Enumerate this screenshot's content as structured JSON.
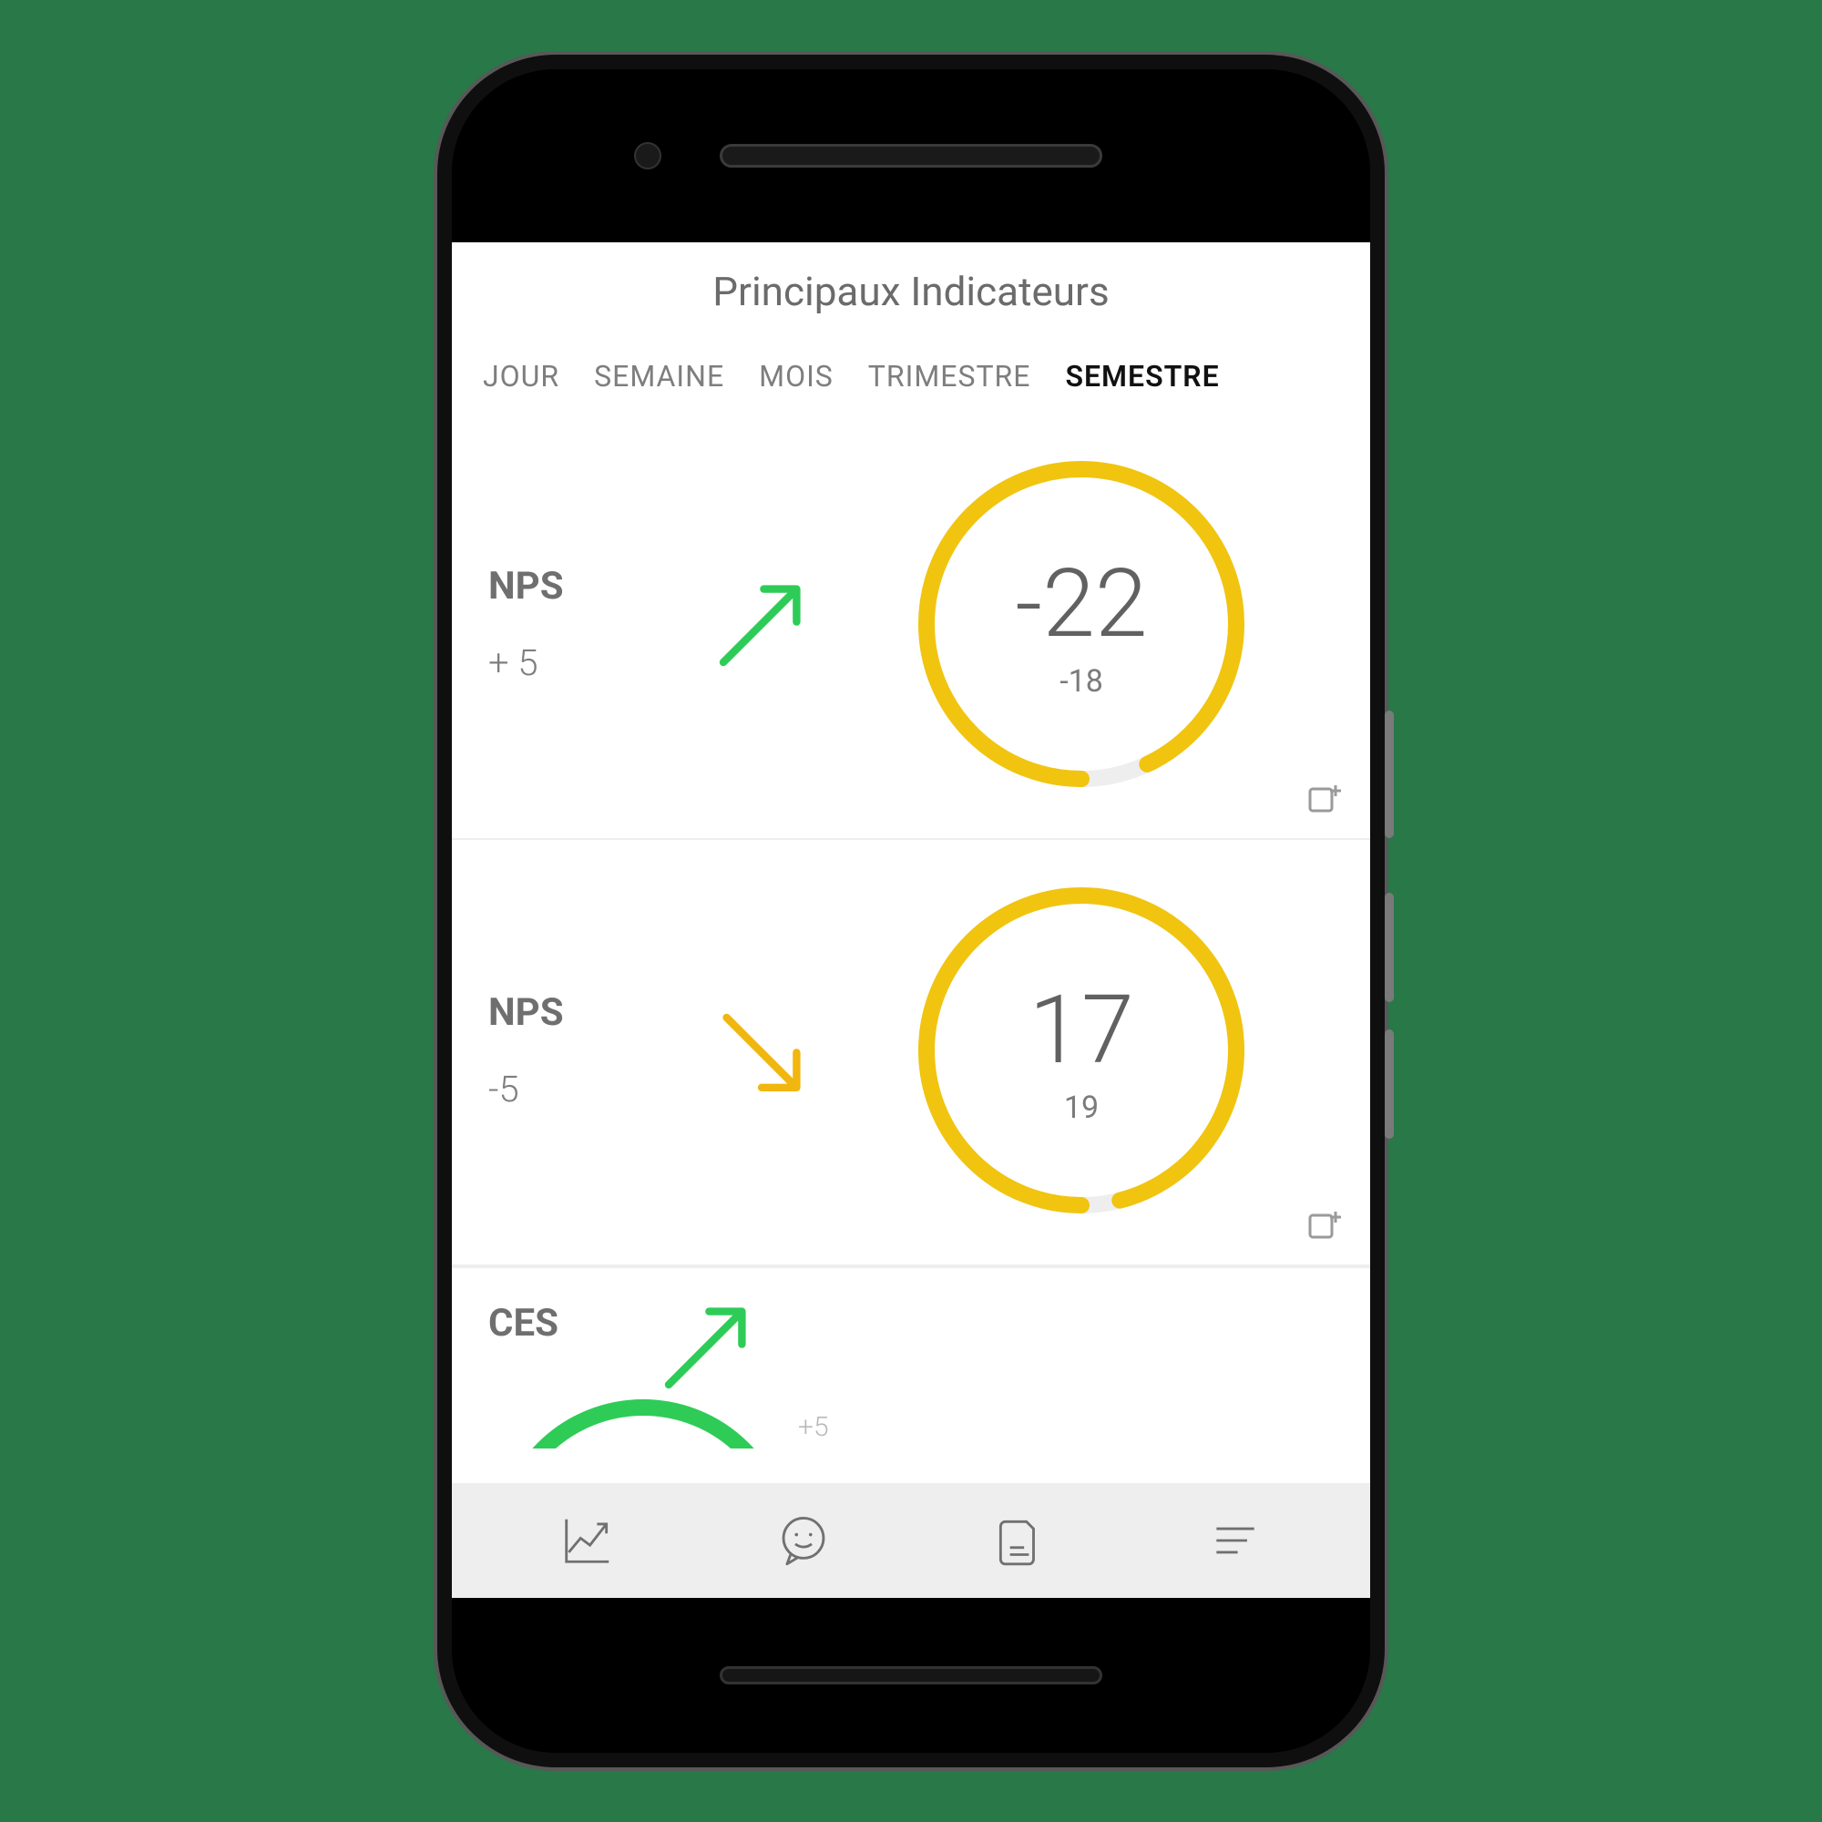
{
  "header": {
    "title": "Principaux Indicateurs"
  },
  "tabs": {
    "items": [
      {
        "label": "JOUR"
      },
      {
        "label": "SEMAINE"
      },
      {
        "label": "MOIS"
      },
      {
        "label": "TRIMESTRE"
      },
      {
        "label": "SEMESTRE"
      }
    ],
    "active_index": 4
  },
  "cards": [
    {
      "name": "NPS",
      "delta": "+ 5",
      "trend": "up",
      "trend_color": "#2ecc57",
      "gauge_value": "-22",
      "gauge_sub": "-18",
      "gauge_color": "#f1c40f",
      "gauge_fraction": 0.93
    },
    {
      "name": "NPS",
      "delta": "-5",
      "trend": "down",
      "trend_color": "#f1b60f",
      "gauge_value": "17",
      "gauge_sub": "19",
      "gauge_color": "#f1c40f",
      "gauge_fraction": 0.96
    },
    {
      "name": "CES",
      "delta": "+5",
      "trend": "up",
      "trend_color": "#2ecc57",
      "gauge_value": "",
      "gauge_sub": "",
      "gauge_color": "#2ecc57",
      "gauge_fraction": 0.9
    }
  ],
  "colors": {
    "background": "#287848",
    "text_muted": "#6b6b6b",
    "green": "#2ecc57",
    "yellow": "#f1c40f"
  }
}
